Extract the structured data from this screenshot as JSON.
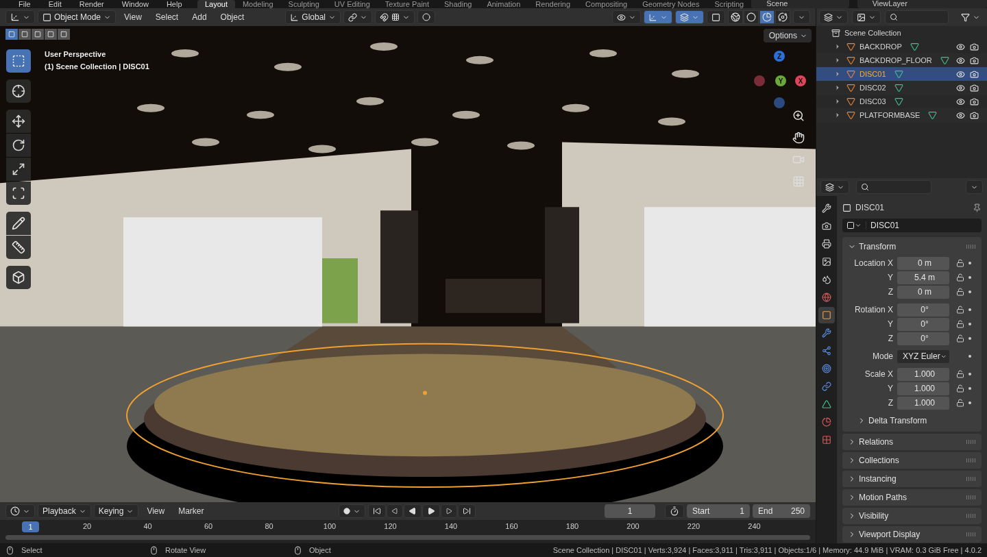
{
  "top_bar": {
    "menus": [
      "File",
      "Edit",
      "Render",
      "Window",
      "Help"
    ],
    "workspaces": [
      {
        "label": "Layout",
        "selected": true
      },
      {
        "label": "Modeling",
        "selected": false
      },
      {
        "label": "Sculpting",
        "selected": false
      },
      {
        "label": "UV Editing",
        "selected": false
      },
      {
        "label": "Texture Paint",
        "selected": false
      },
      {
        "label": "Shading",
        "selected": false
      },
      {
        "label": "Animation",
        "selected": false
      },
      {
        "label": "Rendering",
        "selected": false
      },
      {
        "label": "Compositing",
        "selected": false
      },
      {
        "label": "Geometry Nodes",
        "selected": false
      },
      {
        "label": "Scripting",
        "selected": false
      }
    ],
    "scene": "Scene",
    "view_layer": "ViewLayer"
  },
  "viewport_header": {
    "mode": "Object Mode",
    "menus": [
      "View",
      "Select",
      "Add",
      "Object"
    ],
    "orientation": "Global",
    "toggles": [
      {
        "kind": "visibility",
        "on": false
      },
      {
        "kind": "gizmo",
        "on": true
      },
      {
        "kind": "overlay",
        "on": true
      },
      {
        "kind": "xray",
        "on": false
      }
    ],
    "shading": [
      {
        "kind": "wireframe",
        "selected": false
      },
      {
        "kind": "solid",
        "selected": false
      },
      {
        "kind": "material",
        "selected": true
      },
      {
        "kind": "rendered",
        "selected": false
      }
    ]
  },
  "viewport": {
    "perspective": "User Perspective",
    "context": "(1) Scene Collection | DISC01",
    "options": "Options",
    "select_modes": [
      {
        "selected": true
      },
      {
        "selected": false
      },
      {
        "selected": false
      },
      {
        "selected": false
      },
      {
        "selected": false
      }
    ],
    "tools": [
      {
        "kind": "select",
        "selected": true
      },
      {
        "kind": "cursor",
        "selected": false
      },
      {
        "kind": "move",
        "selected": false
      },
      {
        "kind": "rotate",
        "selected": false
      },
      {
        "kind": "scale",
        "selected": false
      },
      {
        "kind": "transform",
        "selected": false
      },
      {
        "kind": "annotate",
        "selected": false
      },
      {
        "kind": "measure",
        "selected": false
      },
      {
        "kind": "add_cube",
        "selected": false
      }
    ],
    "gizmo_axes": [
      "Z",
      "Y",
      "X"
    ]
  },
  "outliner": {
    "root": "Scene Collection",
    "items": [
      {
        "name": "BACKDROP",
        "selected": false
      },
      {
        "name": "BACKDROP_FLOOR",
        "selected": false
      },
      {
        "name": "DISC01",
        "selected": true
      },
      {
        "name": "DISC02",
        "selected": false
      },
      {
        "name": "DISC03",
        "selected": false
      },
      {
        "name": "PLATFORMBASE",
        "selected": false
      }
    ]
  },
  "properties": {
    "object_name": "DISC01",
    "datablock": "DISC01",
    "tabs": [
      {
        "kind": "tool",
        "selected": false
      },
      {
        "kind": "render",
        "selected": false
      },
      {
        "kind": "output",
        "selected": false
      },
      {
        "kind": "view_layer",
        "selected": false
      },
      {
        "kind": "scene",
        "selected": false
      },
      {
        "kind": "world",
        "selected": false
      },
      {
        "kind": "object",
        "selected": true
      },
      {
        "kind": "modifiers",
        "selected": false
      },
      {
        "kind": "particles",
        "selected": false
      },
      {
        "kind": "physics",
        "selected": false
      },
      {
        "kind": "constraints",
        "selected": false
      },
      {
        "kind": "data",
        "selected": false
      },
      {
        "kind": "material",
        "selected": false
      },
      {
        "kind": "texture",
        "selected": false
      }
    ],
    "transform": {
      "title": "Transform",
      "expanded": true,
      "groups": [
        {
          "rows": [
            {
              "label": "Location X",
              "value": "0 m"
            },
            {
              "label": "Y",
              "value": "5.4 m"
            },
            {
              "label": "Z",
              "value": "0 m"
            }
          ]
        },
        {
          "rows": [
            {
              "label": "Rotation X",
              "value": "0°"
            },
            {
              "label": "Y",
              "value": "0°"
            },
            {
              "label": "Z",
              "value": "0°"
            }
          ]
        },
        {
          "mode_label": "Mode",
          "mode": "XYZ Euler"
        },
        {
          "rows": [
            {
              "label": "Scale X",
              "value": "1.000"
            },
            {
              "label": "Y",
              "value": "1.000"
            },
            {
              "label": "Z",
              "value": "1.000"
            }
          ]
        }
      ],
      "subpanel": {
        "title": "Delta Transform",
        "expanded": false
      }
    },
    "panels": [
      {
        "title": "Relations",
        "expanded": false
      },
      {
        "title": "Collections",
        "expanded": false
      },
      {
        "title": "Instancing",
        "expanded": false
      },
      {
        "title": "Motion Paths",
        "expanded": false
      },
      {
        "title": "Visibility",
        "expanded": false
      },
      {
        "title": "Viewport Display",
        "expanded": false
      }
    ]
  },
  "timeline": {
    "menus": [
      "Playback",
      "Keying",
      "View",
      "Marker"
    ],
    "current_frame": "1",
    "start_label": "Start",
    "start": "1",
    "end_label": "End",
    "end": "250",
    "playhead": "1",
    "ruler": [
      "20",
      "40",
      "60",
      "80",
      "100",
      "120",
      "140",
      "160",
      "180",
      "200",
      "220",
      "240"
    ]
  },
  "status_bar": {
    "hints": [
      "Select",
      "Rotate View",
      "Object"
    ],
    "stats": "Scene Collection | DISC01 | Verts:3,924 | Faces:3,911 | Tris:3,911 | Objects:1/6 | Memory: 44.9 MiB | VRAM: 0.3 GiB Free | 4.0.2"
  }
}
